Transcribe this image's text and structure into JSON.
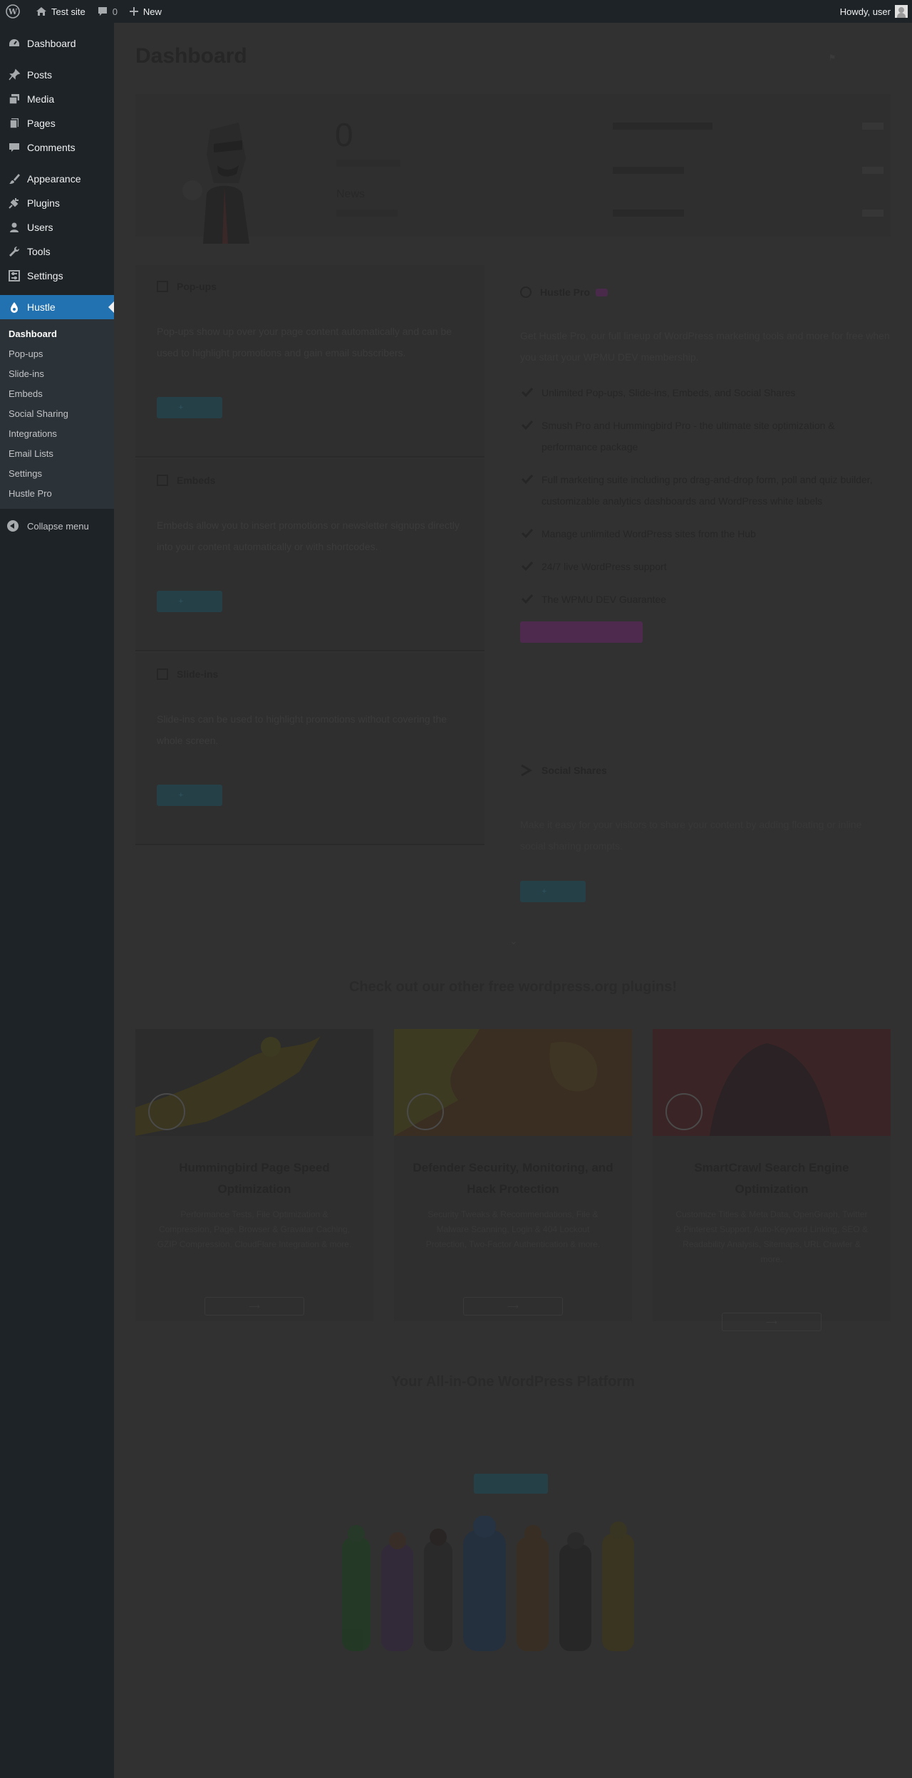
{
  "adminbar": {
    "site_name": "Test site",
    "comments_count": "0",
    "new_label": "New",
    "greeting": "Howdy, user"
  },
  "sidebar": {
    "items": [
      {
        "label": "Dashboard",
        "icon": "dashboard-icon"
      },
      {
        "label": "Posts",
        "icon": "pin-icon"
      },
      {
        "label": "Media",
        "icon": "media-icon"
      },
      {
        "label": "Pages",
        "icon": "pages-icon"
      },
      {
        "label": "Comments",
        "icon": "comment-icon"
      },
      {
        "label": "Appearance",
        "icon": "brush-icon"
      },
      {
        "label": "Plugins",
        "icon": "plug-icon"
      },
      {
        "label": "Users",
        "icon": "user-icon"
      },
      {
        "label": "Tools",
        "icon": "wrench-icon"
      },
      {
        "label": "Settings",
        "icon": "settings-icon"
      },
      {
        "label": "Hustle",
        "icon": "hustle-icon"
      }
    ],
    "submenu": [
      "Dashboard",
      "Pop-ups",
      "Slide-ins",
      "Embeds",
      "Social Sharing",
      "Integrations",
      "Email Lists",
      "Settings",
      "Hustle Pro"
    ],
    "collapse_label": "Collapse menu",
    "accent_color": "#2271b1"
  },
  "main": {
    "page_title": "Dashboard",
    "summary": {
      "count": "0",
      "news_label": "News"
    },
    "cards": [
      {
        "title": "Pop-ups",
        "desc": "Pop-ups show up over your page content automatically and can be used to highlight promotions and gain email subscribers."
      },
      {
        "title": "Embeds",
        "desc": "Embeds allow you to insert promotions or newsletter signups directly into your content automatically or with shortcodes."
      },
      {
        "title": "Slide-ins",
        "desc": "Slide-ins can be used to highlight promotions without covering the whole screen."
      }
    ],
    "pro": {
      "title": "Hustle Pro",
      "desc": "Get Hustle Pro, our full lineup of WordPress marketing tools and more for free when you start your WPMU DEV membership.",
      "features": [
        "Unlimited Pop-ups, Slide-ins, Embeds, and Social Shares",
        "Smush Pro and Hummingbird Pro - the ultimate site optimization & performance package",
        "Full marketing suite including pro drag-and-drop form, poll and quiz builder, customizable analytics dashboards and WordPress white labels",
        "Manage unlimited WordPress sites from the Hub",
        "24/7 live WordPress support",
        "The WPMU DEV Guarantee"
      ]
    },
    "social": {
      "title": "Social Shares",
      "desc": "Make it easy for your visitors to share your content by adding floating or inline social sharing prompts."
    },
    "plugins_heading": "Check out our other free wordpress.org plugins!",
    "plugins": [
      {
        "title": "Hummingbird Page Speed Optimization",
        "desc": "Performance Tests, File Optimization & Compression, Page, Browser & Gravatar Caching, GZIP Compression, CloudFlare Integration & more."
      },
      {
        "title": "Defender Security, Monitoring, and Hack Protection",
        "desc": "Security Tweaks & Recommendations, File & Malware Scanning, Login & 404 Lockout Protection, Two-Factor Authentication & more."
      },
      {
        "title": "SmartCrawl Search Engine Optimization",
        "desc": "Customize Titles & Meta Data, OpenGraph, Twitter & Pinterest Support, Auto-Keyword Linking, SEO & Readability Analysis, Sitemaps, URL Crawler & more."
      }
    ],
    "platform_heading": "Your All-in-One WordPress Platform"
  }
}
